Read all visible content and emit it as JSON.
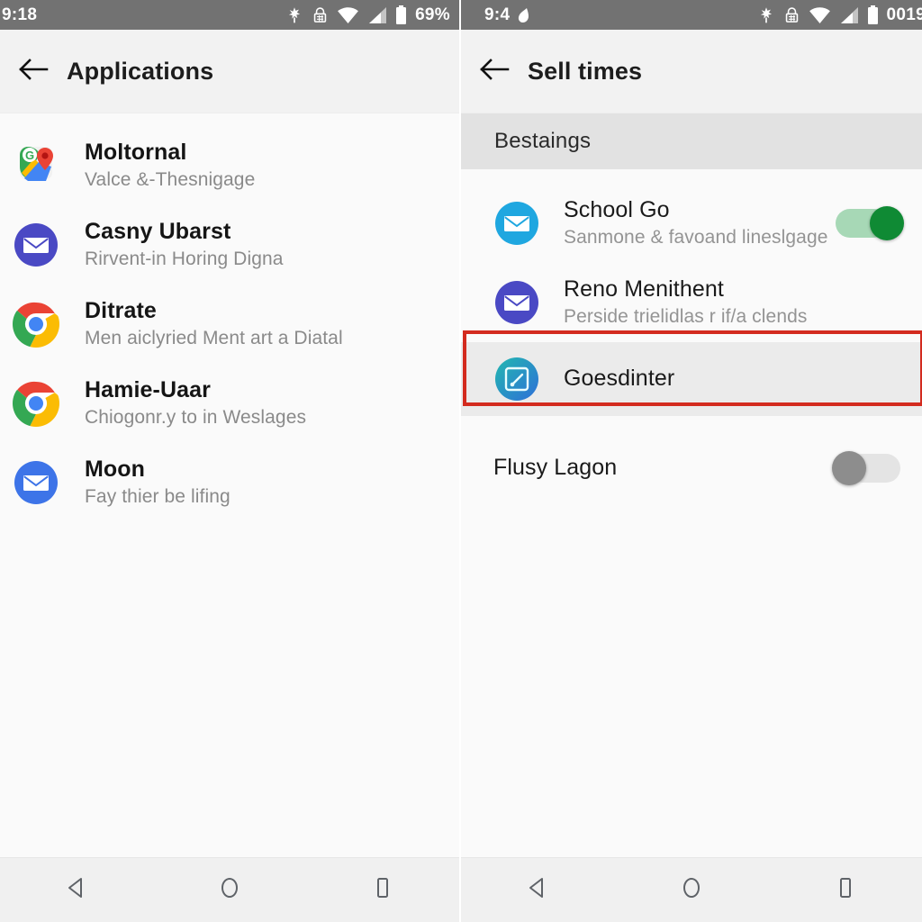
{
  "left": {
    "statusbar": {
      "time": "9:18",
      "battery_pct": "69%",
      "icons": [
        "sparkle-icon",
        "lock-icon",
        "wifi-icon",
        "signal-icon",
        "battery-icon"
      ]
    },
    "appbar": {
      "back_icon": "back-arrow-icon",
      "title": "Applications"
    },
    "apps": [
      {
        "title": "Moltornal",
        "subtitle": "Valce &-Thesnigage",
        "icon": "google-maps-icon"
      },
      {
        "title": "Casny Ubarst",
        "subtitle": "Rirvent-in Horing Digna",
        "icon": "mail-icon-indigo"
      },
      {
        "title": "Ditrate",
        "subtitle": "Men aiclyried Ment art a Diatal",
        "icon": "chrome-icon"
      },
      {
        "title": "Hamie-Uaar",
        "subtitle": "Chiogonr.y to in Weslages",
        "icon": "chrome-icon"
      },
      {
        "title": "Moon",
        "subtitle": "Fay thier be lifing",
        "icon": "mail-icon-blue"
      }
    ],
    "navbar": {
      "back": "nav-back-icon",
      "home": "nav-home-icon",
      "recents": "nav-recents-icon"
    }
  },
  "right": {
    "statusbar": {
      "time": "9:4",
      "battery_pct": "0019",
      "icons": [
        "sparkle-icon",
        "lock-icon",
        "wifi-icon",
        "signal-icon",
        "battery-icon"
      ]
    },
    "appbar": {
      "back_icon": "back-arrow-icon",
      "title": "Sell times"
    },
    "section_header": "Bestaings",
    "items": [
      {
        "title": "School Go",
        "subtitle": "Sanmone & favoand lineslgage",
        "icon": "mail-icon-lightblue",
        "toggle": "on",
        "highlighted": false
      },
      {
        "title": "Reno Menithent",
        "subtitle": "Perside trielidlas r if/a clends",
        "icon": "mail-icon-indigo",
        "toggle": "none",
        "highlighted": false
      },
      {
        "title": "Goesdinter",
        "subtitle": "",
        "icon": "gauge-icon-teal",
        "toggle": "none",
        "highlighted": true
      },
      {
        "title": "Flusy Lagon",
        "subtitle": "",
        "icon": "none",
        "toggle": "off",
        "highlighted": false
      }
    ],
    "navbar": {
      "back": "nav-back-icon",
      "home": "nav-home-icon",
      "recents": "nav-recents-icon"
    }
  },
  "colors": {
    "statusbar_bg": "#727272",
    "appbar_bg": "#f2f2f2",
    "content_bg": "#fafafa",
    "section_header_bg": "#e2e2e2",
    "highlight_border": "#d32b1f",
    "highlight_row_bg": "#ebebeb",
    "toggle_on": "#0f8a34",
    "toggle_off": "#8d8d8d",
    "navbar_bg": "#f0f0f0"
  }
}
